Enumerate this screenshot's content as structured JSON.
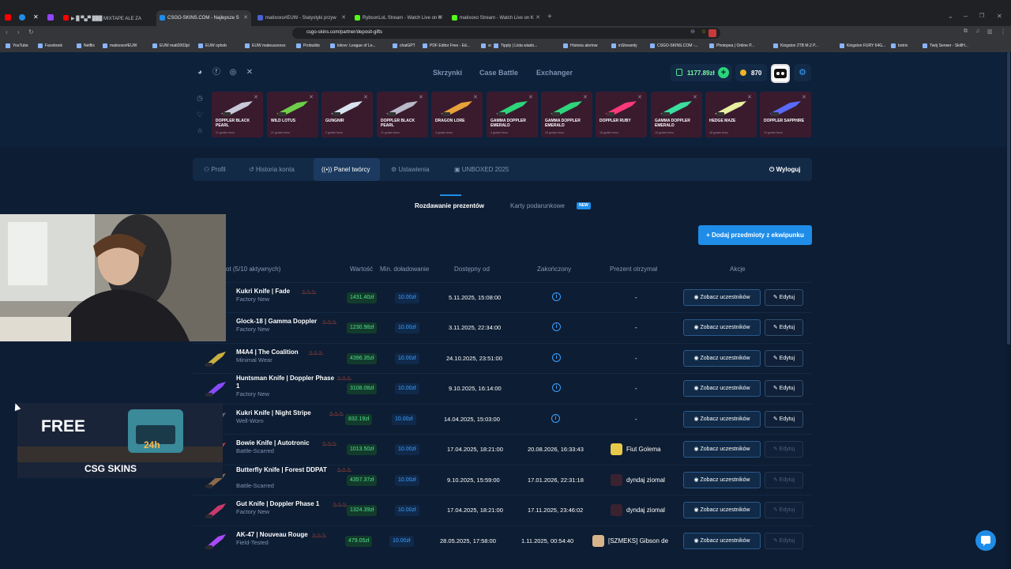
{
  "browser": {
    "tabs": [
      {
        "label": "▶ █ ▀▄▀ ███ MIXTAPE ALE ZA",
        "color": "#ff0000"
      },
      {
        "label": "CSGO-SKINS.COM - Najlepsze S",
        "color": "#1f8de8"
      },
      {
        "label": "matixoxo#EUW - Statystyki przyw",
        "color": "#4a63d4"
      },
      {
        "label": "RybsonLoL Stream - Watch Live on K",
        "color": "#53fc18"
      },
      {
        "label": "matixoxo Stream - Watch Live on K",
        "color": "#53fc18"
      }
    ],
    "url": "csgo-skins.com/partner/deposit-gifts",
    "bookmarks": [
      "YouTube",
      "Facebook",
      "Netflix",
      "matixoxo#EUW",
      "EUW matt2003pl",
      "EUW ophob",
      "EUW mateuszxoxo",
      "Probuilds",
      "lolvvv: League of Le...",
      "chatGPT",
      "PDF Editor Free - Ed...",
      "sr",
      "Tipply | Lista wiado...",
      "Historia alertow",
      "inStreamly",
      "CSGO-SKINS.COM -...",
      "Photopea | Online P...",
      "Kingston 2TB M.2 P...",
      "Kingston FURY 64G...",
      "botrix",
      "Twój Serwer - SkillH..."
    ]
  },
  "header": {
    "nav": [
      "Skrzynki",
      "Case Battle",
      "Exchanger"
    ],
    "balance": "1177.89zł",
    "coins": "870"
  },
  "drops": [
    {
      "name": "DOPPLER BLACK PEARL",
      "time": "21 godzin temu",
      "color": "#c8c8d8"
    },
    {
      "name": "WILD LOTUS",
      "time": "21 godzin temu",
      "color": "#6fcf4a"
    },
    {
      "name": "GUNGNIR",
      "time": "2 godzin temu",
      "color": "#d8e4f0"
    },
    {
      "name": "DOPPLER BLACK PEARL",
      "time": "21 godzin temu",
      "color": "#b8b8c8"
    },
    {
      "name": "DRAGON LORE",
      "time": "3 godzin temu",
      "color": "#e8a23a"
    },
    {
      "name": "GAMMA DOPPLER EMERALD",
      "time": "4 godzin temu",
      "color": "#2ed67b"
    },
    {
      "name": "GAMMA DOPPLER EMERALD",
      "time": "16 godzin temu",
      "color": "#2ed67b"
    },
    {
      "name": "DOPPLER RUBY",
      "time": "16 godzin temu",
      "color": "#ff3a7a"
    },
    {
      "name": "GAMMA DOPPLER EMERALD",
      "time": "16 godzin temu",
      "color": "#3ae0a0"
    },
    {
      "name": "HEDGE MAZE",
      "time": "18 godzin temu",
      "color": "#e8f0a0"
    },
    {
      "name": "DOPPLER SAPPHIRE",
      "time": "19 godzin temu",
      "color": "#5a6aff"
    }
  ],
  "profile_tabs": [
    "Profil",
    "Historia konta",
    "Panel twórcy",
    "Ustawienia",
    "UNBOXED 2025"
  ],
  "logout": "Wyloguj",
  "subtabs": {
    "giveaways": "Rozdawanie prezentów",
    "gift_cards": "Karty podarunkowe",
    "new_badge": "NEW"
  },
  "add_items": "+ Dodaj przedmioty z ekwipunku",
  "columns": {
    "item": "ot (5/10 aktywnych)",
    "value": "Wartość",
    "min_deposit": "Min. doładowanie",
    "available_from": "Dostępny od",
    "ended": "Zakończony",
    "winner": "Prezent otrzymał",
    "actions": "Akcje"
  },
  "row_actions": {
    "see": "Zobacz uczestników",
    "edit": "Edytuj",
    "dash": "-"
  },
  "rows": [
    {
      "name": "Kukri Knife | Fade",
      "wear": "Factory New",
      "value": "1431.40zł",
      "min": "10.00zł",
      "from": "5.11.2025, 15:08:00",
      "ended": "",
      "winner": "",
      "img": "#ff7a3a"
    },
    {
      "name": "Glock-18 | Gamma Doppler",
      "wear": "Factory New",
      "value": "1230.98zł",
      "min": "10.00zł",
      "from": "3.11.2025, 22:34:00",
      "ended": "",
      "winner": "",
      "img": "#3aa0ff"
    },
    {
      "name": "M4A4 | The Coalition",
      "wear": "Minimal Wear",
      "value": "4396.35zł",
      "min": "10.00zł",
      "from": "24.10.2025, 23:51:00",
      "ended": "",
      "winner": "",
      "img": "#c8b040"
    },
    {
      "name": "Huntsman Knife | Doppler Phase 1",
      "wear": "Factory New",
      "value": "3108.08zł",
      "min": "10.00zł",
      "from": "9.10.2025, 16:14:00",
      "ended": "",
      "winner": "",
      "img": "#8a4aff"
    },
    {
      "name": "Kukri Knife | Night Stripe",
      "wear": "Well-Worn",
      "value": "832.19zł",
      "min": "10.00zł",
      "from": "14.04.2025, 15:03:00",
      "ended": "",
      "winner": "",
      "img": "#6a6a7a"
    },
    {
      "name": "Bowie Knife | Autotronic",
      "wear": "Battle-Scarred",
      "value": "1013.50zł",
      "min": "10.00zł",
      "from": "17.04.2025, 18:21:00",
      "ended": "20.08.2026, 16:33:43",
      "winner": "Fiut Golema",
      "img": "#c83a3a"
    },
    {
      "name": "Butterfly Knife | Forest DDPAT",
      "wear": "Battle-Scarred",
      "value": "4357.37zł",
      "min": "10.00zł",
      "from": "9.10.2025, 15:59:00",
      "ended": "17.01.2026, 22:31:18",
      "winner": "dyndaj ziomal",
      "img": "#8a6a4a"
    },
    {
      "name": "Gut Knife | Doppler Phase 1",
      "wear": "Factory New",
      "value": "1324.39zł",
      "min": "10.00zł",
      "from": "17.04.2025, 18:21:00",
      "ended": "17.11.2025, 23:46:02",
      "winner": "dyndaj ziomal",
      "img": "#c83a6a"
    },
    {
      "name": "AK-47 | Nouveau Rouge",
      "wear": "Field-Tested",
      "value": "479.05zł",
      "min": "10.00zł",
      "from": "28.05.2025, 17:58:00",
      "ended": "1.11.2025, 00:54:40",
      "winner": "[SZMEKS] Gibson de",
      "img": "#a84aff"
    }
  ],
  "overlay": {
    "ad_free": "FREE",
    "ad_brand": "CSG SKINS",
    "ad_timer": "24h"
  }
}
